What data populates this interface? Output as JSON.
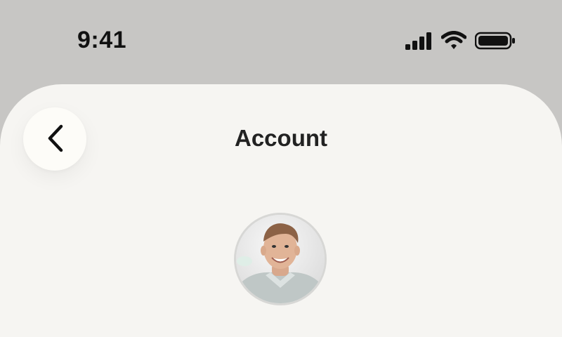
{
  "status_bar": {
    "time": "9:41",
    "icons": [
      "signal-icon",
      "wifi-icon",
      "battery-icon"
    ]
  },
  "header": {
    "title": "Account",
    "back_icon": "chevron-left-icon"
  },
  "profile": {
    "avatar": "avatar"
  },
  "colors": {
    "status_bg": "#c7c6c4",
    "sheet_bg": "#f6f5f2",
    "button_bg": "#fdfcf8",
    "text": "#222222"
  }
}
